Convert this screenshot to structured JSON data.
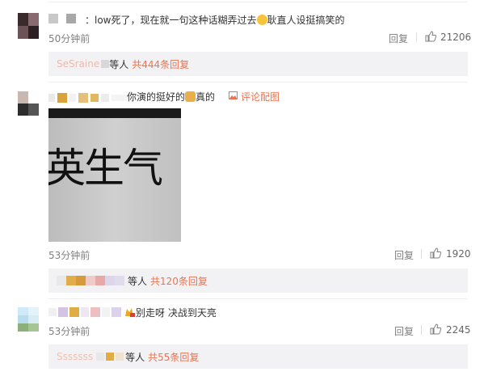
{
  "comment1": {
    "text_a": "：low死了，现在就一句这种话糊弄过去",
    "text_b": "耿直人设挺搞笑的",
    "time": "50分钟前",
    "reply_label": "回复",
    "likes": "21206",
    "sub_name": "SeSraine",
    "sub_etc": "等人",
    "sub_count": "共444条回复"
  },
  "comment2": {
    "text_a": "你演的挺好的",
    "text_b": "真的",
    "pic_link": "评论配图",
    "image_text": "英生气",
    "time": "53分钟前",
    "reply_label": "回复",
    "likes": "1920",
    "sub_etc": "等人",
    "sub_count": "共120条回复"
  },
  "comment3": {
    "text": "别走呀 决战到天亮",
    "time": "53分钟前",
    "reply_label": "回复",
    "likes": "2245",
    "sub_name": "Sssssss",
    "sub_etc": "等人",
    "sub_count": "共55条回复"
  }
}
